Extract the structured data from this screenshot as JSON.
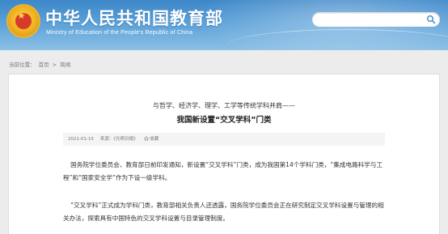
{
  "header": {
    "title": "中华人民共和国教育部",
    "subtitle": "Ministry of Education of the People's Republic of China",
    "search_placeholder": ""
  },
  "icons": {
    "emblem": "national-emblem",
    "search": "search-icon",
    "favorite": "star-icon"
  },
  "breadcrumb": {
    "prefix": "当前位置：",
    "items": [
      "首页",
      "简闻"
    ],
    "separator": ">"
  },
  "article": {
    "pre_title": "与哲学、经济学、理学、工学等传统学科并肩——",
    "title": "我国新设置“交叉学科”门类",
    "date": "2021-01-15",
    "source": "来源：《光明日报》",
    "favorite_label": "收藏",
    "paragraphs": [
      "国务院学位委员会、教育部日前印发通知，新设置“交叉学科”门类，成为我国第14个学科门类，“集成电路科学与工程”和“国家安全学”作为下设一级学科。",
      "“交叉学科”正式成为学科门类，教育部相关负责人还透露，国务院学位委员会正在研究制定交叉学科设置与管理的相关办法，探索具有中国特色的交叉学科设置与目录管理制度。"
    ]
  },
  "colors": {
    "header_blue": "#3d87c8",
    "emblem_gold": "#f0b020",
    "emblem_red": "#d63a2a"
  }
}
